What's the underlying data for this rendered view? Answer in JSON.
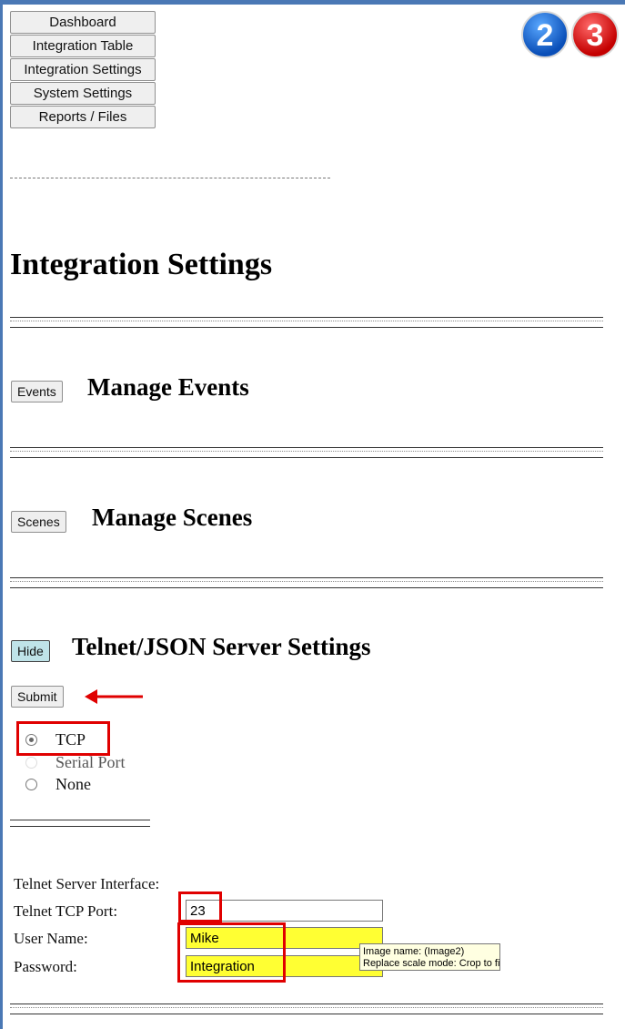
{
  "nav": {
    "items": [
      {
        "label": "Dashboard"
      },
      {
        "label": "Integration Table"
      },
      {
        "label": "Integration Settings"
      },
      {
        "label": "System Settings"
      },
      {
        "label": "Reports / Files"
      }
    ]
  },
  "badges": {
    "first": "2",
    "second": "3"
  },
  "page": {
    "title": "Integration Settings"
  },
  "sections": {
    "events": {
      "button_label": "Events",
      "title": "Manage Events"
    },
    "scenes": {
      "button_label": "Scenes",
      "title": "Manage Scenes"
    },
    "telnet": {
      "button_label": "Hide",
      "title": "Telnet/JSON Server Settings"
    }
  },
  "submit_label": "Submit",
  "connection_options": [
    {
      "label": "TCP",
      "checked": true
    },
    {
      "label": "Serial Port",
      "checked": false
    },
    {
      "label": "None",
      "checked": false
    }
  ],
  "form": {
    "interface_label": "Telnet Server Interface:",
    "port_label": "Telnet TCP Port:",
    "port_value": "23",
    "username_label": "User Name:",
    "username_value": "Mike",
    "password_label": "Password:",
    "password_value": "Integration"
  },
  "tooltip": {
    "line1": "Image name: (Image2)",
    "line2": "Replace scale mode: Crop to fit"
  },
  "colors": {
    "accent_frame": "#4a78b5",
    "annotation_red": "#e00000",
    "highlight_yellow": "#ffff33"
  }
}
